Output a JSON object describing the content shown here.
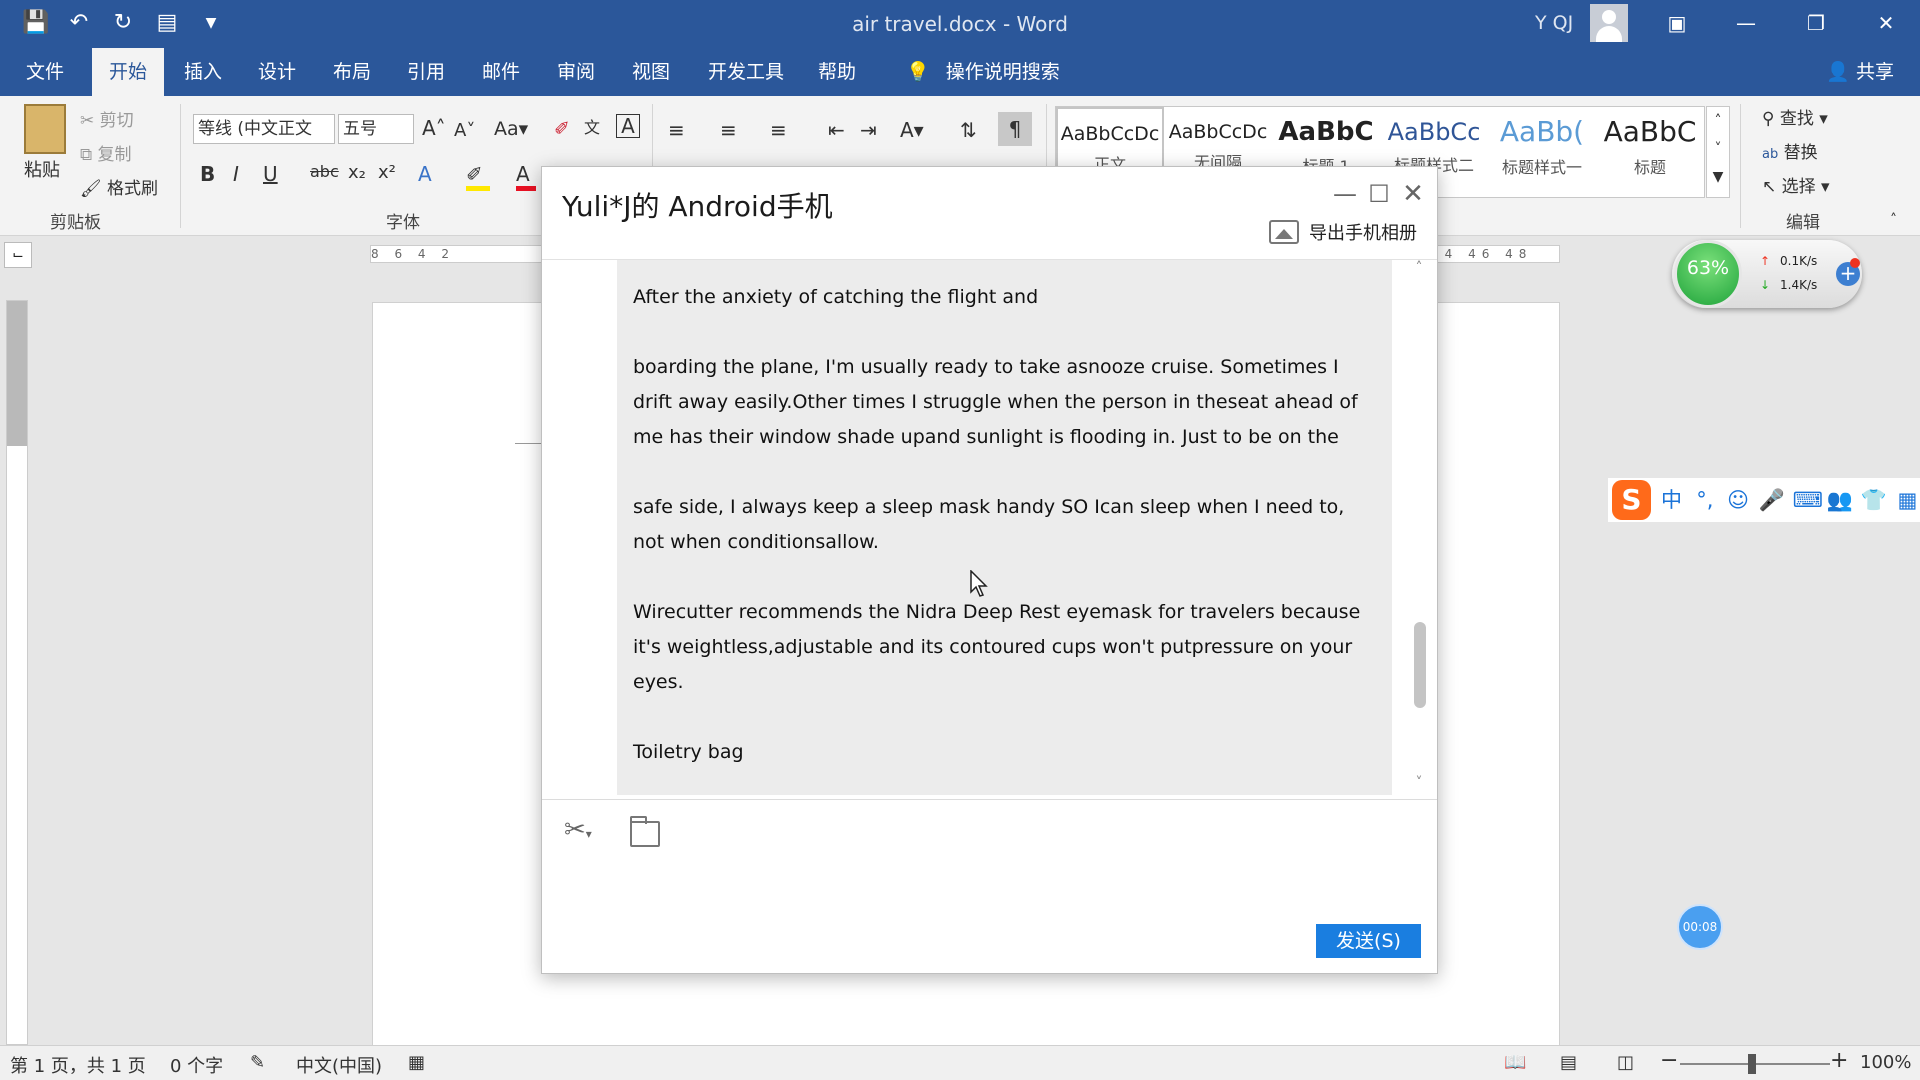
{
  "window": {
    "title": "air travel.docx  -  Word",
    "user": "Y QJ"
  },
  "tabs": [
    "文件",
    "开始",
    "插入",
    "设计",
    "布局",
    "引用",
    "邮件",
    "审阅",
    "视图",
    "开发工具",
    "帮助"
  ],
  "active_tab": "开始",
  "tell_me": "操作说明搜索",
  "share": "共享",
  "ribbon": {
    "clipboard": {
      "paste": "粘贴",
      "cut": "剪切",
      "copy": "复制",
      "format_painter": "格式刷",
      "label": "剪贴板"
    },
    "font": {
      "font_name": "等线 (中文正文",
      "font_size": "五号",
      "label": "字体"
    },
    "styles": [
      {
        "sample": "AaBbCcDc",
        "name": "正文"
      },
      {
        "sample": "AaBbCcDc",
        "name": "无间隔"
      },
      {
        "sample": "AaBbC",
        "name": "标题 1"
      },
      {
        "sample": "AaBbCc",
        "name": "标题样式二"
      },
      {
        "sample": "AaBb(",
        "name": "标题样式一"
      },
      {
        "sample": "AaBbC",
        "name": "标题"
      }
    ],
    "editing": {
      "find": "查找",
      "replace": "替换",
      "select": "选择",
      "label": "编辑"
    }
  },
  "ruler": {
    "h_ticks": "8  6  4  2",
    "h_ticks_right": "44  46  48"
  },
  "status": {
    "page": "第 1 页，共 1 页",
    "words": "0 个字",
    "language": "中文(中国)",
    "zoom": "100%"
  },
  "net_widget": {
    "percent": "63%",
    "up": "0.1K/s",
    "down": "1.4K/s"
  },
  "ime": {
    "logo": "S",
    "mode": "中",
    "punct": "°,"
  },
  "timer": "00:08",
  "dialog": {
    "title": "Yuli*J的 Android手机",
    "export_album": "导出手机相册",
    "messages": [
      "After the anxiety of catching the flight and",
      "boarding the plane, I'm usually ready to take asnooze cruise. Sometimes I drift away easily.Other times I struggle when the person in theseat ahead of me has their window shade upand sunlight is flooding in. Just to be on the",
      "safe side, I always keep a sleep mask handy SO Ican sleep when I need to, not when conditionsallow.",
      "Wirecutter recommends the Nidra Deep Rest eyemask for travelers because it's weightless,adjustable and its contoured cups won't putpressure on your eyes.",
      "Toiletry bag"
    ],
    "send": "发送(S)"
  },
  "colors": {
    "word_blue": "#2b579a",
    "send_blue": "#1a7ee0"
  }
}
